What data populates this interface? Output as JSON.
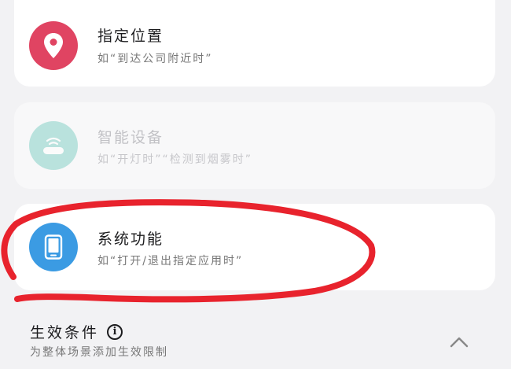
{
  "colors": {
    "location_icon_bg": "#e04462",
    "smart_icon_bg": "#6fc9bd",
    "system_icon_bg": "#3b9be3",
    "annotation_stroke": "#e8232d"
  },
  "options": [
    {
      "icon": "location-pin-icon",
      "title": "指定位置",
      "subtitle": "如“到达公司附近时”"
    },
    {
      "icon": "smart-device-icon",
      "title": "智能设备",
      "subtitle": "如“开灯时”“检测到烟雾时”"
    },
    {
      "icon": "phone-icon",
      "title": "系统功能",
      "subtitle": "如“打开/退出指定应用时”"
    }
  ],
  "footer": {
    "title": "生效条件",
    "info_icon": "info-icon",
    "subtitle": "为整体场景添加生效限制",
    "toggle_icon": "chevron-up-icon"
  }
}
